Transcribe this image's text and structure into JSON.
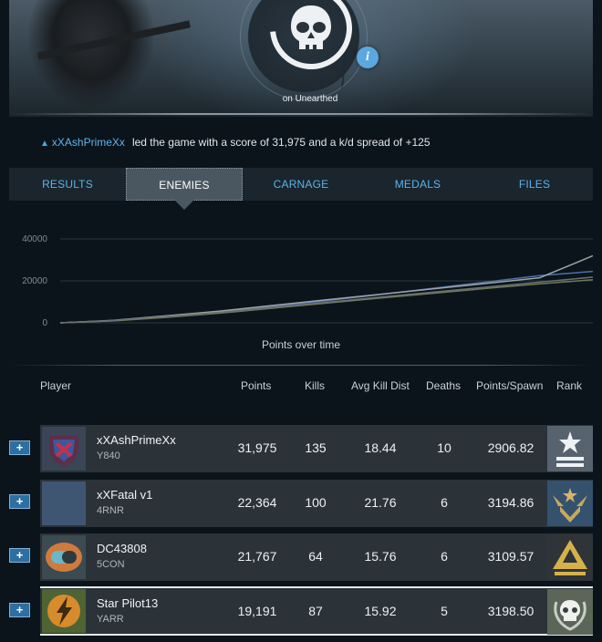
{
  "header": {
    "map_label": "on Unearthed",
    "info_glyph": "i",
    "emblem_icon": "skull-emblem-icon"
  },
  "summary": {
    "leader": "xXAshPrimeXx",
    "text": "led the game with a score of 31,975 and a k/d spread of +125"
  },
  "tabs": [
    {
      "label": "RESULTS",
      "active": false
    },
    {
      "label": "ENEMIES",
      "active": true
    },
    {
      "label": "CARNAGE",
      "active": false
    },
    {
      "label": "MEDALS",
      "active": false
    },
    {
      "label": "FILES",
      "active": false
    }
  ],
  "chart_data": {
    "type": "line",
    "title": "Points over time",
    "xlabel": "",
    "ylabel": "",
    "ylim": [
      0,
      40000
    ],
    "yticks": [
      "40000",
      "20000",
      "0"
    ],
    "grid": true,
    "series": [
      {
        "color": "#4e6fa8",
        "values": [
          0,
          1000,
          3000,
          5200,
          8000,
          10500,
          13500,
          16500,
          19500,
          22500,
          24500
        ]
      },
      {
        "color": "#9aa3a8",
        "values": [
          0,
          1200,
          3400,
          5600,
          8300,
          11000,
          13600,
          16200,
          18800,
          21500,
          31975
        ]
      },
      {
        "color": "#6f7a52",
        "values": [
          0,
          900,
          2600,
          4600,
          7000,
          9400,
          11800,
          14100,
          16400,
          18600,
          20500
        ]
      },
      {
        "color": "#6b6f73",
        "values": [
          0,
          1100,
          3000,
          5000,
          7400,
          9800,
          12200,
          14600,
          17000,
          19400,
          21800
        ]
      }
    ]
  },
  "table": {
    "columns": [
      "Player",
      "Points",
      "Kills",
      "Avg Kill Dist",
      "Deaths",
      "Points/Spawn",
      "Rank"
    ],
    "expand_glyph": "+",
    "rows": [
      {
        "name": "xXAshPrimeXx",
        "tag": "Y840",
        "points": "31,975",
        "kills": "135",
        "avg_kill_dist": "18.44",
        "deaths": "10",
        "points_per_spawn": "2906.82",
        "emblem_icon": "shield-emblem-icon",
        "rank_icon": "star-chevron-rank-icon",
        "highlighted": false
      },
      {
        "name": "xXFatal v1",
        "tag": "4RNR",
        "points": "22,364",
        "kills": "100",
        "avg_kill_dist": "21.76",
        "deaths": "6",
        "points_per_spawn": "3194.86",
        "emblem_icon": "blank-emblem-icon",
        "rank_icon": "winged-chevron-rank-icon",
        "highlighted": false
      },
      {
        "name": "DC43808",
        "tag": "5CON",
        "points": "21,767",
        "kills": "64",
        "avg_kill_dist": "15.76",
        "deaths": "6",
        "points_per_spawn": "3109.57",
        "emblem_icon": "capsule-emblem-icon",
        "rank_icon": "gold-triangle-rank-icon",
        "highlighted": false
      },
      {
        "name": "Star Pilot13",
        "tag": "YARR",
        "points": "19,191",
        "kills": "87",
        "avg_kill_dist": "15.92",
        "deaths": "5",
        "points_per_spawn": "3198.50",
        "emblem_icon": "lightning-emblem-icon",
        "rank_icon": "skull-wreath-rank-icon",
        "highlighted": true
      }
    ]
  }
}
